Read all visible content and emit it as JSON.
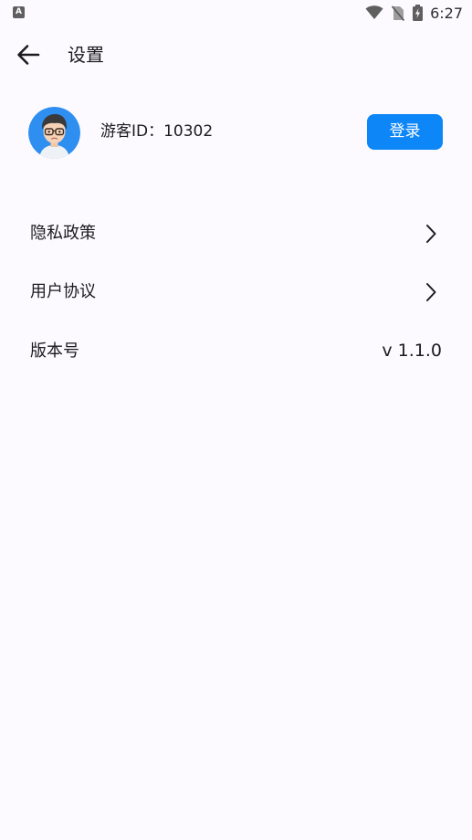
{
  "status_bar": {
    "left_icon_letter": "A",
    "time": "6:27"
  },
  "header": {
    "title": "设置"
  },
  "profile": {
    "guest_id_text": "游客ID：10302",
    "login_label": "登录"
  },
  "menu": {
    "privacy_policy": "隐私政策",
    "user_agreement": "用户协议",
    "version_label": "版本号",
    "version_value": "v 1.1.0"
  },
  "colors": {
    "accent": "#0d86f8",
    "background": "#fdfaff",
    "text": "#1c1b1f"
  },
  "icons": {
    "back": "arrow-left-icon",
    "chevron": "chevron-right-icon",
    "wifi": "wifi-icon",
    "no_sim": "no-sim-icon",
    "battery": "battery-charging-icon"
  }
}
